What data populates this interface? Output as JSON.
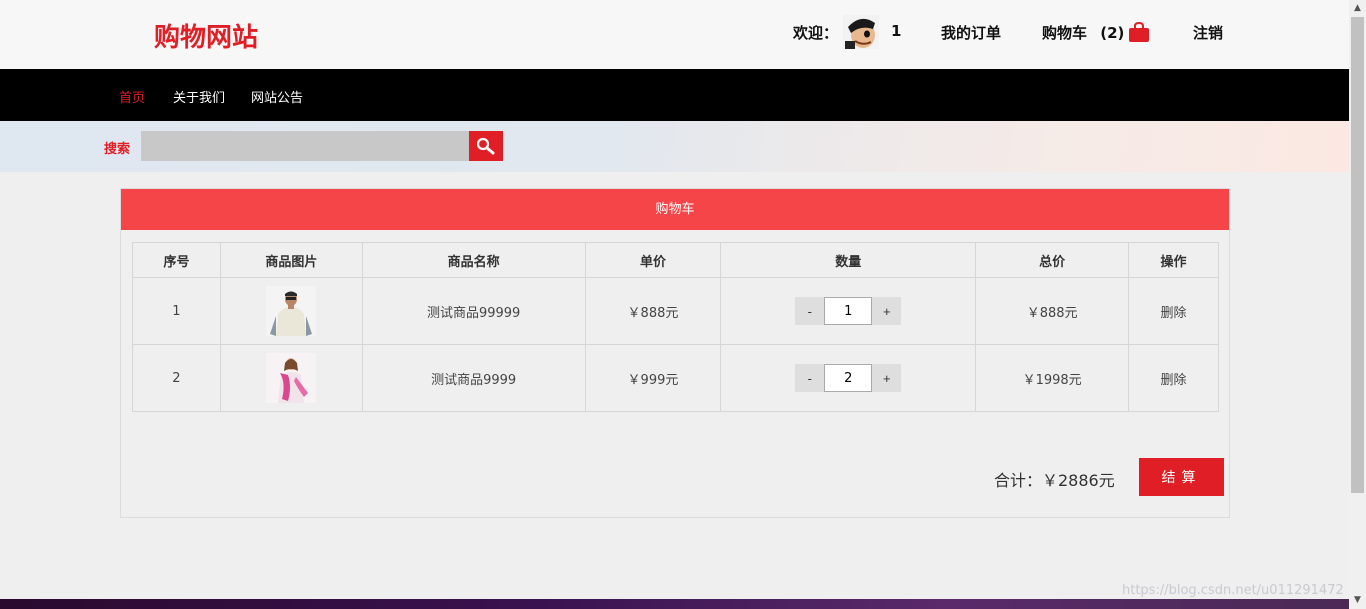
{
  "header": {
    "logo": "购物网站",
    "welcome_label": "欢迎：",
    "username": "1",
    "orders_label": "我的订单",
    "cart_label": "购物车",
    "cart_count": "(2)",
    "logout_label": "注销"
  },
  "nav": {
    "items": [
      {
        "label": "首页",
        "active": true
      },
      {
        "label": "关于我们",
        "active": false
      },
      {
        "label": "网站公告",
        "active": false
      }
    ]
  },
  "search": {
    "label": "搜索",
    "value": "",
    "placeholder": ""
  },
  "cart": {
    "title": "购物车",
    "columns": [
      "序号",
      "商品图片",
      "商品名称",
      "单价",
      "数量",
      "总价",
      "操作"
    ],
    "rows": [
      {
        "index": "1",
        "image": "product-man-tshirt",
        "name": "测试商品99999",
        "unit_price": "￥888元",
        "quantity": "1",
        "total": "￥888元",
        "action": "删除"
      },
      {
        "index": "2",
        "image": "product-woman-scarf",
        "name": "测试商品9999",
        "unit_price": "￥999元",
        "quantity": "2",
        "total": "￥1998元",
        "action": "删除"
      }
    ],
    "decrement_label": "-",
    "increment_label": "+",
    "sum_text": "合计：￥2886元",
    "checkout_label": "结算"
  },
  "watermark": "https://blog.csdn.net/u011291472",
  "colors": {
    "accent": "#e01e26",
    "panel_header": "#f64548",
    "nav_bg": "#000000"
  }
}
